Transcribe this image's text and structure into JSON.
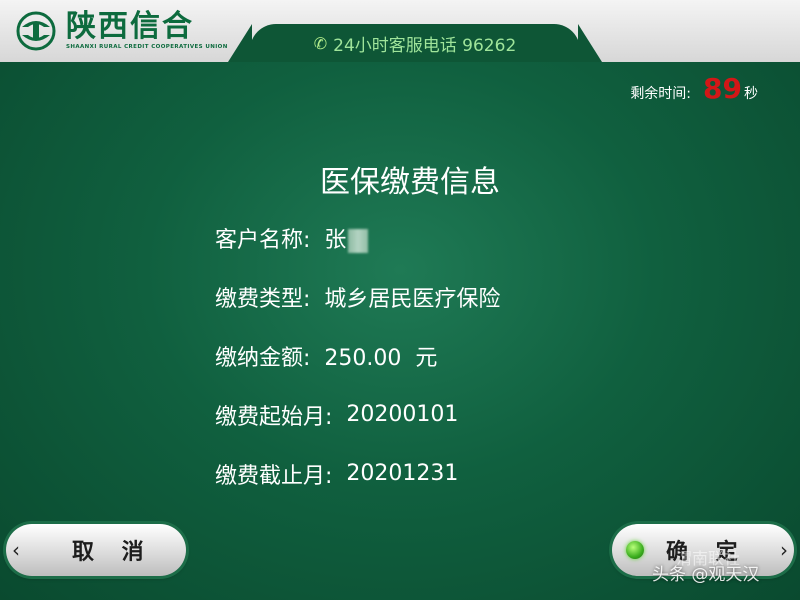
{
  "header": {
    "logo_cn": "陕西信合",
    "logo_en": "SHAANXI RURAL CREDIT COOPERATIVES UNION",
    "hotline": "24小时客服电话 96262"
  },
  "timer": {
    "label": "剩余时间:",
    "value": "89",
    "unit": "秒"
  },
  "main": {
    "title": "医保缴费信息",
    "fields": [
      {
        "label": "客户名称:",
        "value": "张"
      },
      {
        "label": "缴费类型:",
        "value": "城乡居民医疗保险"
      },
      {
        "label": "缴纳金额:",
        "value": "250.00  元"
      },
      {
        "label": "缴费起始月:",
        "value": "20200101"
      },
      {
        "label": "缴费截止月:",
        "value": "20201231"
      }
    ]
  },
  "buttons": {
    "cancel": "取 消",
    "cancel_arrow": "‹",
    "confirm": "确 定",
    "confirm_arrow": "›"
  },
  "watermark": {
    "text": "头条 @观天汉",
    "text2": "渭南联社"
  },
  "colors": {
    "background": "#10603f",
    "brand_green": "#0d6b3e",
    "timer_red": "#d21717",
    "hotline_green": "#9fe49a"
  }
}
